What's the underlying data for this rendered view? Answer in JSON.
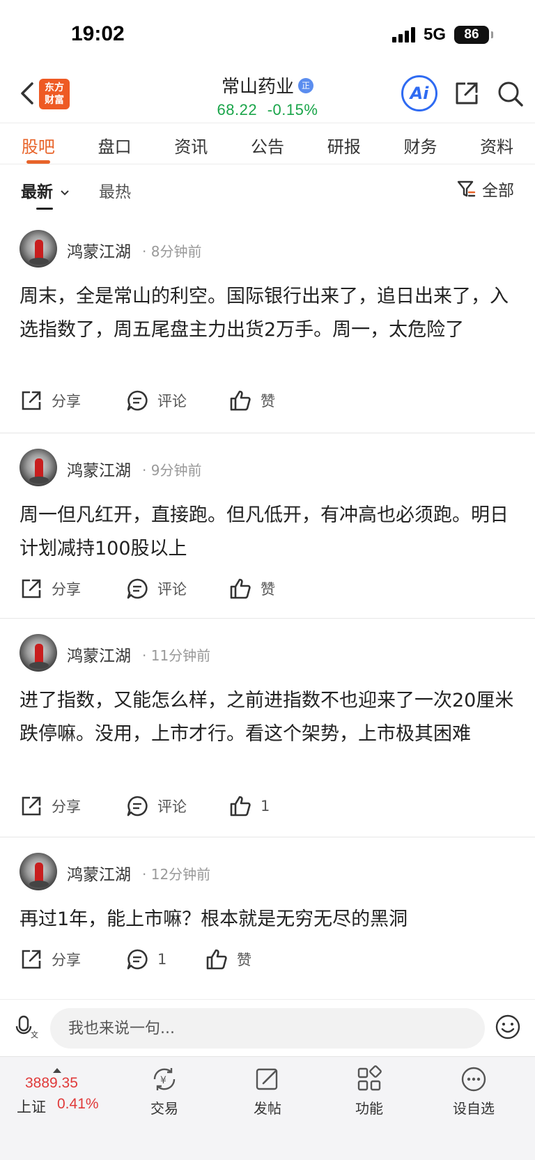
{
  "status_bar": {
    "time": "19:02",
    "network": "5G",
    "battery": "86"
  },
  "header": {
    "logo_line1": "东方",
    "logo_line2": "财富",
    "stock_name": "常山药业",
    "badge": "正",
    "price": "68.22",
    "change": "-0.15%",
    "ai_label": "Ai"
  },
  "tabs": [
    "股吧",
    "盘口",
    "资讯",
    "公告",
    "研报",
    "财务",
    "资料"
  ],
  "active_tab": 0,
  "sort": {
    "latest": "最新",
    "hot": "最热",
    "filter_label": "全部"
  },
  "posts": [
    {
      "author": "鸿蒙江湖",
      "time": "· 8分钟前",
      "content": "周末，全是常山的利空。国际银行出来了，追日出来了，入选指数了，周五尾盘主力出货2万手。周一，太危险了",
      "share": "分享",
      "comment": "评论",
      "like": "赞"
    },
    {
      "author": "鸿蒙江湖",
      "time": "· 9分钟前",
      "content": "周一但凡红开，直接跑。但凡低开，有冲高也必须跑。明日计划减持100股以上",
      "share": "分享",
      "comment": "评论",
      "like": "赞"
    },
    {
      "author": "鸿蒙江湖",
      "time": "· 11分钟前",
      "content": "进了指数，又能怎么样，之前进指数不也迎来了一次20厘米跌停嘛。没用，上市才行。看这个架势，上市极其困难",
      "share": "分享",
      "comment": "评论",
      "like": "1"
    },
    {
      "author": "鸿蒙江湖",
      "time": "· 12分钟前",
      "content": "再过1年，能上市嘛？根本就是无穷无尽的黑洞",
      "share": "分享",
      "comment": "1",
      "like": "赞"
    }
  ],
  "comment_bar": {
    "placeholder": "我也来说一句..."
  },
  "bottom_nav": {
    "index_value": "3889.35",
    "index_name": "上证",
    "index_change": "0.41%",
    "items": [
      "交易",
      "发帖",
      "功能",
      "设自选"
    ]
  },
  "colors": {
    "accent": "#e8642a",
    "up": "#e03a3a",
    "down": "#1aa54a",
    "ai_blue": "#2f6bf2"
  }
}
